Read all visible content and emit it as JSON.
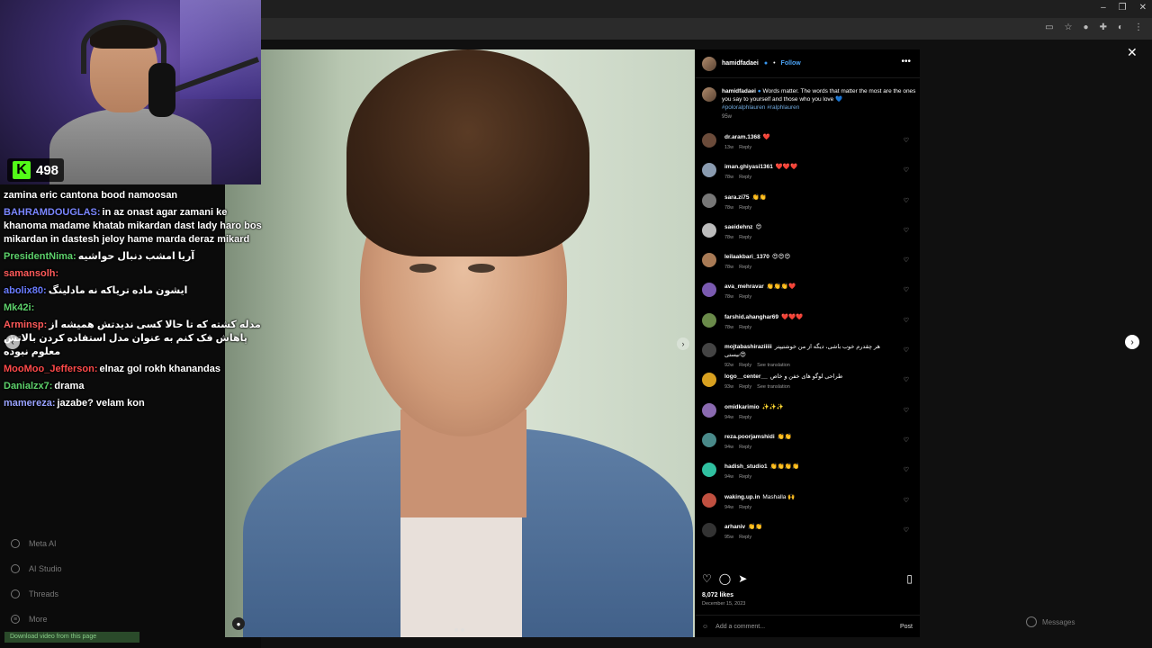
{
  "stream": {
    "viewer_count": "498"
  },
  "chat": [
    {
      "user": "",
      "text": "zamina eric cantona bood namoosan",
      "color": "#ffffff"
    },
    {
      "user": "BAHRAMDOUGLAS:",
      "text": "in az onast agar zamani ke khanoma madame khatab mikardan dast lady haro bos mikardan in dastesh jeloy hame marda deraz mikard",
      "color": "#7a86ff"
    },
    {
      "user": "PresidentNima:",
      "text": "آریا امشب دنبال حواشیه",
      "color": "#5dd16b"
    },
    {
      "user": "samansolh:",
      "text": "",
      "color": "#ff5a5a"
    },
    {
      "user": "abolix80:",
      "text": "ایشون ماده تریاکه نه مادلینگ",
      "color": "#6a7cff"
    },
    {
      "user": "Mk42i:",
      "text": "",
      "color": "#5dd16b"
    },
    {
      "user": "Arminsp:",
      "text": "مدله کشته که تا حالا کسی ندیدتش همیشه از پاهاش فک کنم به عنوان مدل استفاده کردن بالاتش معلوم نبوده",
      "color": "#ff5a5a"
    },
    {
      "user": "MooMoo_Jefferson:",
      "text": "elnaz gol rokh khanandas",
      "color": "#ff4a4a"
    },
    {
      "user": "Danialzx7:",
      "text": "drama",
      "color": "#5dd16b"
    },
    {
      "user": "mamereza:",
      "text": "jazabe? velam kon",
      "color": "#9aa3ff"
    }
  ],
  "nav": [
    "Meta AI",
    "AI Studio",
    "Threads",
    "More"
  ],
  "post": {
    "username": "hamidfadaei",
    "follow_label": "Follow",
    "caption": "Words matter. The words that matter the most are the ones you say to yourself and those who you love 💙",
    "hashtags": "#poloralphlauren #ralphlauren",
    "caption_age": "95w",
    "comments": [
      {
        "user": "dr.aram.1368",
        "text": "❤️",
        "age": "13w",
        "reply": "Reply",
        "translate": "",
        "color": "#6b4b3a"
      },
      {
        "user": "iman.ghiyasi1361",
        "text": "❤️❤️❤️",
        "age": "78w",
        "reply": "Reply",
        "translate": "",
        "color": "#8a9bb0"
      },
      {
        "user": "sara.zi75",
        "text": "👏👏",
        "age": "78w",
        "reply": "Reply",
        "translate": "",
        "color": "#777777"
      },
      {
        "user": "saeidehnz",
        "text": "😍",
        "age": "78w",
        "reply": "Reply",
        "translate": "",
        "color": "#bbbbbb"
      },
      {
        "user": "leilaakbari_1370",
        "text": "😍😍😍",
        "age": "78w",
        "reply": "Reply",
        "translate": "",
        "color": "#a87a55"
      },
      {
        "user": "ava_mehravar",
        "text": "👏👏👏❤️",
        "age": "78w",
        "reply": "Reply",
        "translate": "",
        "color": "#7a5ab0"
      },
      {
        "user": "farshid.ahanghar69",
        "text": "❤️❤️❤️",
        "age": "78w",
        "reply": "Reply",
        "translate": "",
        "color": "#6a8a4a"
      },
      {
        "user": "mojtabashiraziiiii",
        "text": "هر چقدرم خوب باشی، دیگه از من خوشتیپتر نیستی😍",
        "age": "92w",
        "reply": "Reply",
        "translate": "See translation",
        "color": "#444444"
      },
      {
        "user": "logo__center__",
        "text": "طراحی لوگو های خفن و خاص",
        "age": "93w",
        "reply": "Reply",
        "translate": "See translation",
        "color": "#d8a020"
      },
      {
        "user": "omidkarimio",
        "text": "✨✨✨",
        "age": "94w",
        "reply": "Reply",
        "translate": "",
        "color": "#8a6ab0"
      },
      {
        "user": "reza.poorjamshidi",
        "text": "👏👏",
        "age": "94w",
        "reply": "Reply",
        "translate": "",
        "color": "#4a8a8a"
      },
      {
        "user": "hadish_studio1",
        "text": "👏👏👏👏",
        "age": "94w",
        "reply": "Reply",
        "translate": "",
        "color": "#30c0a0"
      },
      {
        "user": "waking.up.in",
        "text": "Mashalla 🙌",
        "age": "94w",
        "reply": "Reply",
        "translate": "",
        "color": "#c05040"
      },
      {
        "user": "arhaniv",
        "text": "👏👏",
        "age": "95w",
        "reply": "Reply",
        "translate": "",
        "color": "#333333"
      }
    ],
    "likes": "8,072 likes",
    "date": "December 15, 2023",
    "add_comment_placeholder": "Add a comment...",
    "post_label": "Post"
  },
  "messages_label": "Messages",
  "download_bar": "Download video from this page"
}
